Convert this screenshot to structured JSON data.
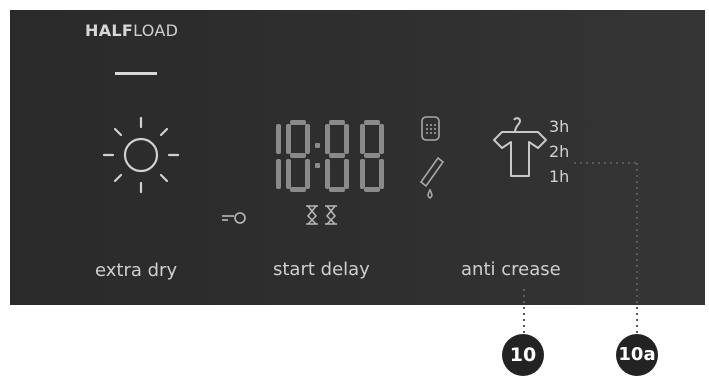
{
  "panel": {
    "halfload": {
      "bold": "HALF",
      "light": "LOAD"
    },
    "labels": {
      "extra_dry": "extra dry",
      "start_delay": "start delay",
      "anti_crease": "anti crease"
    },
    "display": {
      "digits": "18:88"
    },
    "anti_crease_hours": [
      "3h",
      "2h",
      "1h"
    ]
  },
  "callouts": {
    "c10": "10",
    "c10a": "10a"
  },
  "icons": [
    "sun-icon",
    "key-lock-icon",
    "hourglass-icon",
    "water-tank-icon",
    "condenser-filter-icon",
    "shirt-icon"
  ],
  "colors": {
    "panel": "#2f2f2f",
    "text": "#cfcfcf",
    "badge": "#232323"
  }
}
